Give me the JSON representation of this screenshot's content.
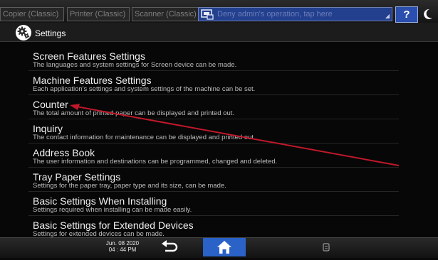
{
  "topbar": {
    "tabs": [
      "Copier (Classic)",
      "Printer (Classic)",
      "Scanner (Classic)"
    ],
    "message": "Deny admin's operation, tap here",
    "help_label": "?",
    "icons": {
      "message": "printer-screen-icon",
      "energy": "energy-saver-icon"
    }
  },
  "title": {
    "text": "Settings",
    "icon": "gear-icon"
  },
  "items": [
    {
      "title": "Screen Features Settings",
      "desc": "The languages and system settings for Screen device can be made."
    },
    {
      "title": "Machine Features Settings",
      "desc": "Each application's settings and system settings of the machine can be set."
    },
    {
      "title": "Counter",
      "desc": "The total amount of printed paper can be displayed and printed out."
    },
    {
      "title": "Inquiry",
      "desc": "The contact information for maintenance can be displayed and printed out."
    },
    {
      "title": "Address Book",
      "desc": "The user information and destinations can be programmed, changed and deleted."
    },
    {
      "title": "Tray Paper Settings",
      "desc": "Settings for the paper tray, paper type and its size, can be made."
    },
    {
      "title": "Basic Settings When Installing",
      "desc": "Settings required when installing can be made easily."
    },
    {
      "title": "Basic Settings for Extended Devices",
      "desc": "Settings for extended devices can be made."
    }
  ],
  "bottombar": {
    "date": "Jun. 08 2020",
    "time": "04 : 44 PM",
    "icons": {
      "back": "back-icon",
      "home": "home-icon",
      "stop": "data-in-icon"
    }
  },
  "colors": {
    "accent": "#2a62c8",
    "annotation": "#c0182a",
    "background": "#070707"
  }
}
